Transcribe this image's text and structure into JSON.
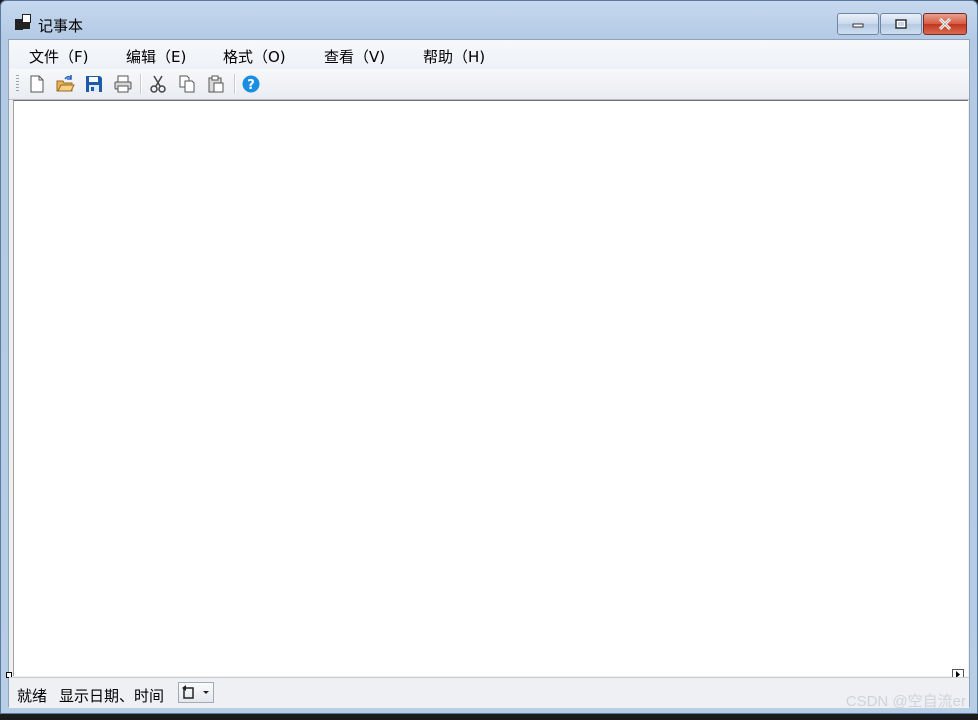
{
  "window": {
    "title": "记事本"
  },
  "menubar": {
    "items": [
      {
        "label": "文件（F)"
      },
      {
        "label": "编辑（E)"
      },
      {
        "label": "格式（O)"
      },
      {
        "label": "查看（V)"
      },
      {
        "label": "帮助（H)"
      }
    ]
  },
  "toolbar": {
    "buttons": [
      "new-file",
      "open-folder",
      "save",
      "print",
      "cut",
      "copy",
      "paste",
      "help"
    ]
  },
  "editor": {
    "content": ""
  },
  "statusbar": {
    "status": "就绪",
    "datetime_label": "显示日期、时间"
  },
  "watermark": "CSDN @空自流er"
}
